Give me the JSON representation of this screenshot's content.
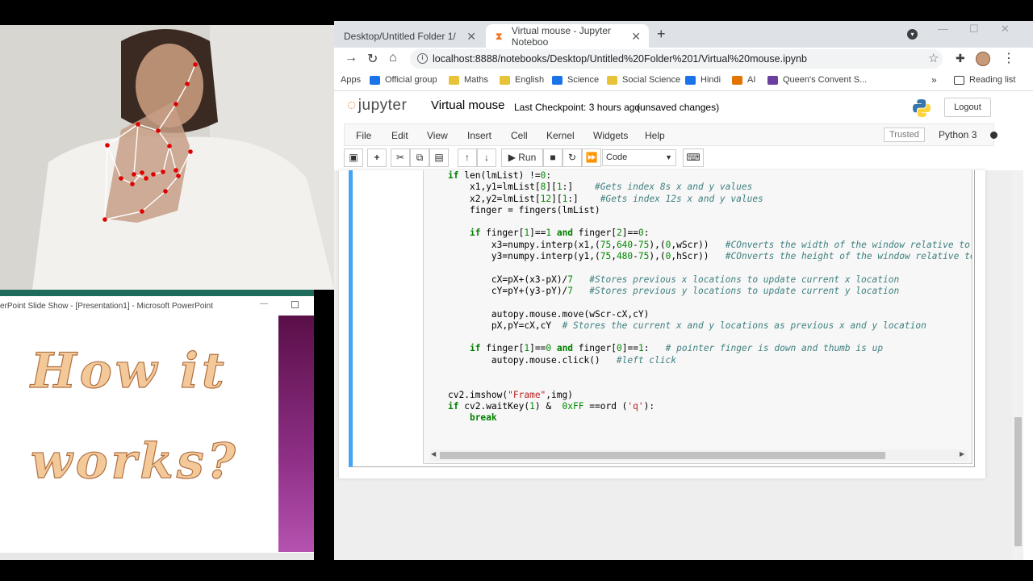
{
  "browser": {
    "tabs": [
      {
        "title": "Desktop/Untitled Folder 1/",
        "close": "✕"
      },
      {
        "title": "Virtual mouse - Jupyter Noteboo",
        "close": "✕"
      }
    ],
    "new_tab": "+",
    "url": "localhost:8888/notebooks/Desktop/Untitled%20Folder%201/Virtual%20mouse.ipynb",
    "bookmarks": [
      {
        "label": "Apps",
        "icon": "apps-grid-icon",
        "color": ""
      },
      {
        "label": "Official group",
        "icon": "folder-icon",
        "color": "#1a73e8"
      },
      {
        "label": "Maths",
        "icon": "folder-icon",
        "color": "#e8c33a"
      },
      {
        "label": "English",
        "icon": "folder-icon",
        "color": "#e8c33a"
      },
      {
        "label": "Science",
        "icon": "folder-icon",
        "color": "#1a73e8"
      },
      {
        "label": "Social Science",
        "icon": "folder-icon",
        "color": "#e8c33a"
      },
      {
        "label": "Hindi",
        "icon": "folder-icon",
        "color": "#1a73e8"
      },
      {
        "label": "AI",
        "icon": "folder-icon",
        "color": "#e37400"
      },
      {
        "label": "Queen's Convent S...",
        "icon": "calendar-icon",
        "color": "#6b3fa0"
      }
    ],
    "bookmarks_more": "»",
    "reading_list": "Reading list"
  },
  "jupyter": {
    "logo_text": "jupyter",
    "notebook_name": "Virtual mouse",
    "checkpoint": "Last Checkpoint: 3 hours ago",
    "unsaved": "(unsaved changes)",
    "logout": "Logout",
    "menu": [
      "File",
      "Edit",
      "View",
      "Insert",
      "Cell",
      "Kernel",
      "Widgets",
      "Help"
    ],
    "trusted": "Trusted",
    "kernel": "Python 3",
    "toolbar": {
      "run": "Run",
      "cell_type": "Code"
    },
    "accent_color": "#42a5f5"
  },
  "code_lines": [
    "if len(lmList) !=0:",
    "    x1,y1=lmList[8][1:]    #Gets index 8s x and y values",
    "    x2,y2=lmList[12][1:]    #Gets index 12s x and y values",
    "    finger = fingers(lmList)",
    "",
    "    if finger[1]==1 and finger[2]==0:",
    "        x3=numpy.interp(x1,(75,640-75),(0,wScr))   #COnverts the width of the window relative to th",
    "        y3=numpy.interp(y1,(75,480-75),(0,hScr))   #COnverts the height of the window relative to t",
    "",
    "        cX=pX+(x3-pX)/7   #Stores previous x locations to update current x location",
    "        cY=pY+(y3-pY)/7   #Stores previous y locations to update current y location",
    "",
    "        autopy.mouse.move(wScr-cX,cY)",
    "        pX,pY=cX,cY  # Stores the current x and y locations as previous x and y location",
    "",
    "    if finger[1]==0 and finger[0]==1:   # pointer finger is down and thumb is up",
    "        autopy.mouse.click()   #left click",
    "",
    "",
    "cv2.imshow(\"Frame\",img)",
    "if cv2.waitKey(1) &  0xFF ==ord ('q'):",
    "    break"
  ],
  "powerpoint": {
    "window_title": "erPoint Slide Show - [Presentation1] - Microsoft PowerPoint",
    "slide_line1": "How it",
    "slide_line2": "works?"
  }
}
